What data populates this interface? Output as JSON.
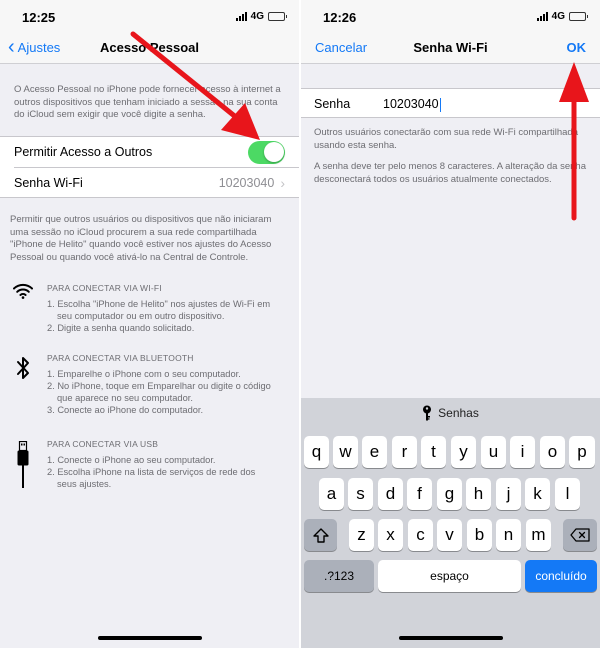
{
  "left_screen": {
    "status": {
      "time": "12:25",
      "network": "4G"
    },
    "nav": {
      "back_label": "Ajustes",
      "title": "Acesso Pessoal"
    },
    "intro_text": "O Acesso Pessoal no iPhone pode fornecer acesso à internet a outros dispositivos que tenham iniciado a sessão na sua conta do iCloud sem exigir que você digite a senha.",
    "cells": {
      "allow_label": "Permitir Acesso a Outros",
      "allow_on": true,
      "wifi_pw_label": "Senha Wi-Fi",
      "wifi_pw_value": "10203040"
    },
    "description_text": "Permitir que outros usuários ou dispositivos que não iniciaram uma sessão no iCloud procurem a sua rede compartilhada \"iPhone de Helito\" quando você estiver nos ajustes do Acesso Pessoal ou quando você ativá-lo na Central de Controle.",
    "methods": [
      {
        "icon": "wifi-icon",
        "title": "PARA CONECTAR VIA WI-FI",
        "steps": [
          "1. Escolha \"iPhone de Helito\" nos ajustes de Wi-Fi em",
          "    seu computador ou em outro dispositivo.",
          "2. Digite a senha quando solicitado."
        ]
      },
      {
        "icon": "bluetooth-icon",
        "title": "PARA CONECTAR VIA BLUETOOTH",
        "steps": [
          "1. Emparelhe o iPhone com o seu computador.",
          "2. No iPhone, toque em Emparelhar ou digite o código",
          "    que aparece no seu computador.",
          "3. Conecte ao iPhone do computador."
        ]
      },
      {
        "icon": "usb-icon",
        "title": "PARA CONECTAR VIA USB",
        "steps": [
          "1. Conecte o iPhone ao seu computador.",
          "2. Escolha iPhone na lista de serviços de rede dos",
          "    seus ajustes."
        ]
      }
    ]
  },
  "right_screen": {
    "status": {
      "time": "12:26",
      "network": "4G"
    },
    "nav": {
      "cancel_label": "Cancelar",
      "title": "Senha Wi-Fi",
      "ok_label": "OK"
    },
    "field": {
      "label": "Senha",
      "value": "10203040"
    },
    "help_text_1": "Outros usuários conectarão com sua rede Wi-Fi compartilhada usando esta senha.",
    "help_text_2": "A senha deve ter pelo menos 8 caracteres. A alteração da senha desconectará todos os usuários atualmente conectados.",
    "keyboard": {
      "bar_label": "Senhas",
      "row1": [
        "q",
        "w",
        "e",
        "r",
        "t",
        "y",
        "u",
        "i",
        "o",
        "p"
      ],
      "row2": [
        "a",
        "s",
        "d",
        "f",
        "g",
        "h",
        "j",
        "k",
        "l"
      ],
      "row3": [
        "z",
        "x",
        "c",
        "v",
        "b",
        "n",
        "m"
      ],
      "numbers_label": ".?123",
      "space_label": "espaço",
      "done_label": "concluído"
    }
  },
  "colors": {
    "ios_blue": "#1479f6",
    "toggle_green": "#4cd964",
    "annotation_red": "#e8151b"
  }
}
